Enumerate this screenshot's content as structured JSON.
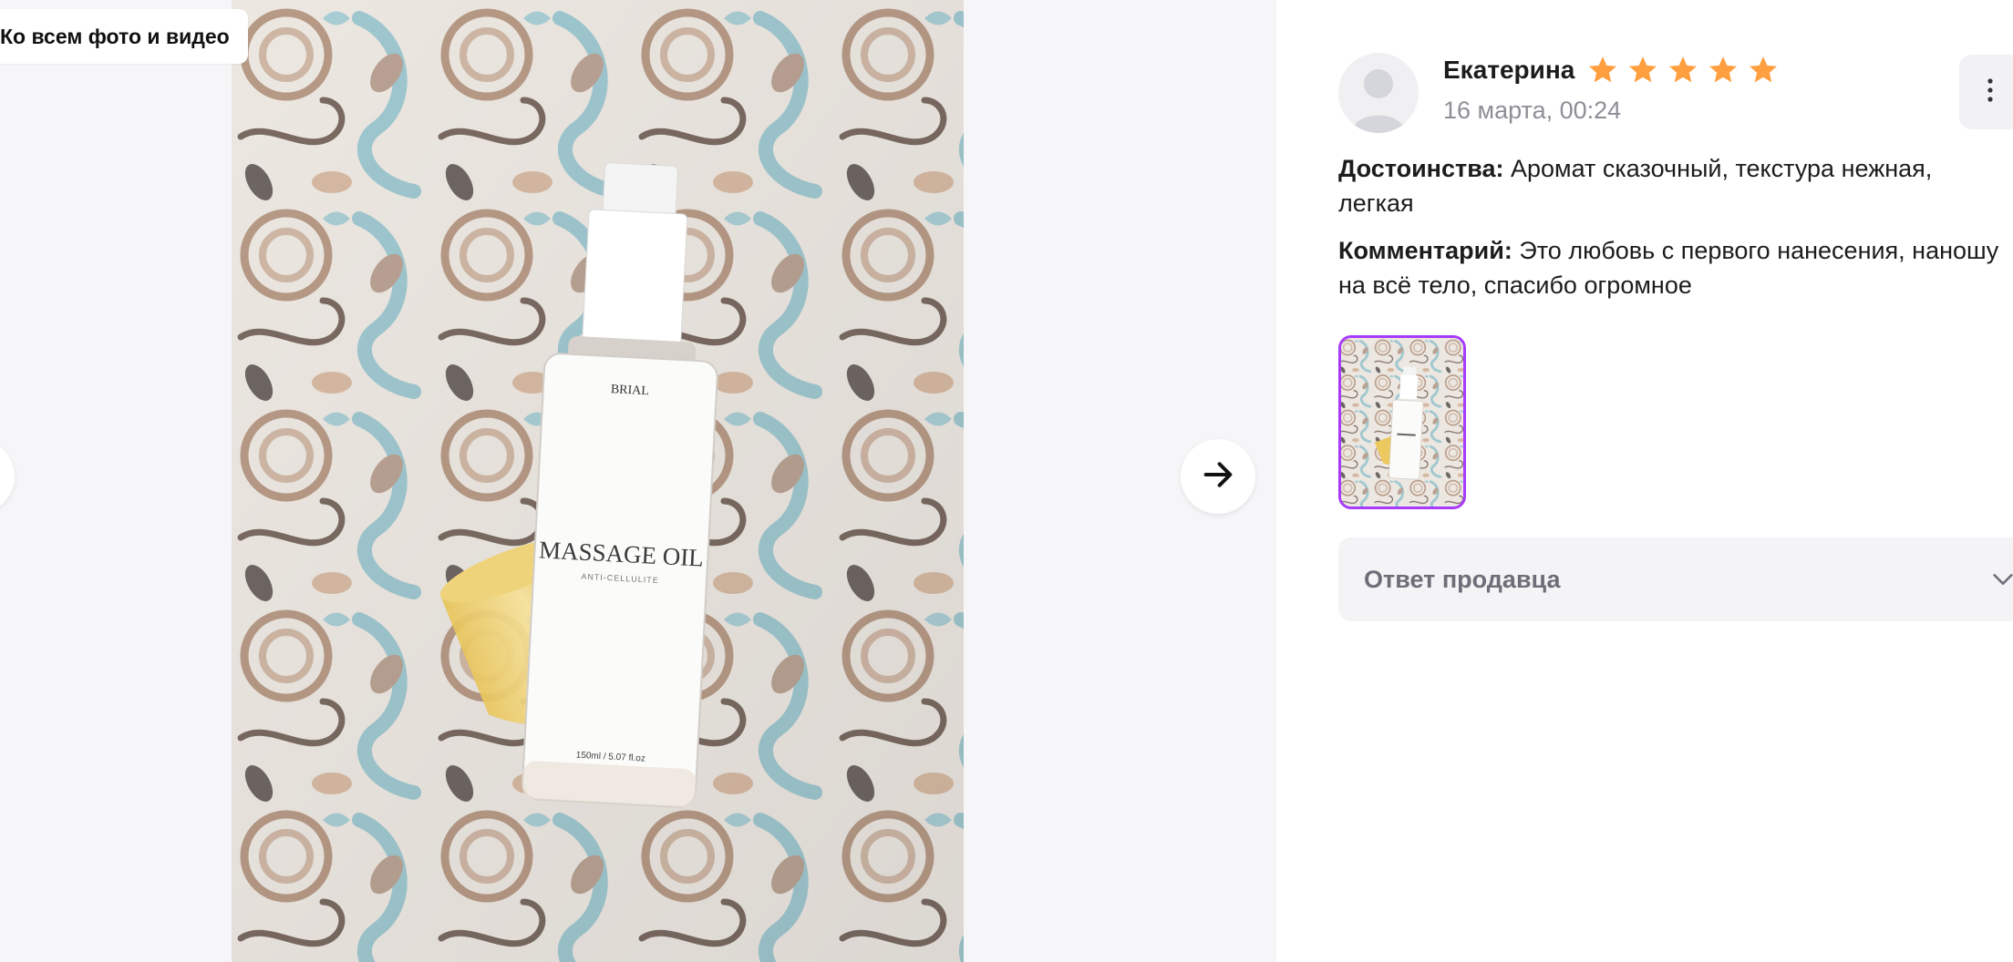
{
  "viewer": {
    "back_label": "Ко всем фото и видео",
    "photo": {
      "bottle_brand": "BRIAL",
      "bottle_title": "MASSAGE OIL",
      "bottle_subtitle": "ANTI-CELLULITE",
      "bottle_volume": "150ml / 5.07 fl.oz"
    },
    "prev_icon": "arrow-left-icon",
    "next_icon": "arrow-right-icon"
  },
  "review": {
    "author": "Екатерина",
    "rating": 5,
    "rating_max": 5,
    "date": "16 марта, 00:24",
    "pros_label": "Достоинства:",
    "pros_text": "Аромат сказочный, текстура нежная, легкая",
    "comment_label": "Комментарий:",
    "comment_text": "Это любовь с первого нанесения, наношу на всё тело, спасибо огромное",
    "seller_reply_label": "Ответ продавца"
  },
  "colors": {
    "star": "#ff9f40",
    "thumb_border": "#a73afd",
    "muted_text": "#8e8e96"
  }
}
